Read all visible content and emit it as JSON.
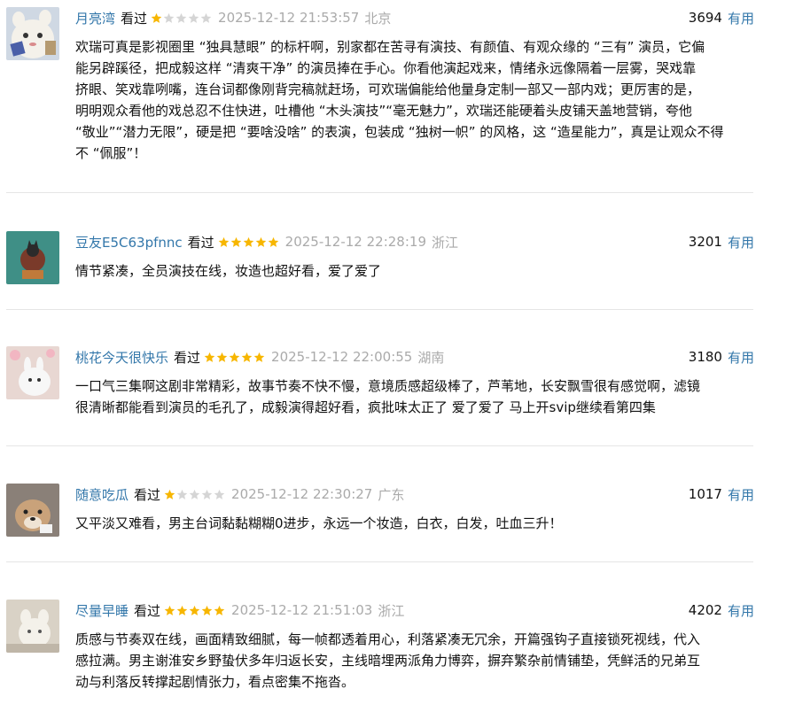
{
  "colors": {
    "link": "#3377aa",
    "star_on": "#f7b600",
    "star_off": "#d5d5d5",
    "meta_gray": "#aaaaaa"
  },
  "reviews": [
    {
      "user": "月亮湾",
      "status": "看过",
      "rating": 1,
      "timestamp": "2025-12-12 21:53:57",
      "location": "北京",
      "votes": "3694",
      "useful_label": "有用",
      "lines": [
        "欢瑞可真是影视圈里 “独具慧眼” 的标杆啊，别家都在苦寻有演技、有颜值、有观众缘的 “三有” 演员，它偏",
        "能另辟蹊径，把成毅这样 “清爽干净” 的演员捧在手心。你看他演起戏来，情绪永远像隔着一层雾，哭戏靠",
        "挤眼、笑戏靠咧嘴，连台词都像刚背完稿就赶场，可欢瑞偏能给他量身定制一部又一部内戏；更厉害的是，",
        "明明观众看他的戏总忍不住快进，吐槽他 “木头演技”“毫无魅力”，欢瑞还能硬着头皮铺天盖地营销，夸他",
        "“敬业”“潜力无限”，硬是把 “要啥没啥” 的表演，包装成 “独树一帜” 的风格，这 “造星能力”，真是让观众不得",
        "不 “佩服”！"
      ]
    },
    {
      "user": "豆友E5C63pfnnc",
      "status": "看过",
      "rating": 5,
      "timestamp": "2025-12-12 22:28:19",
      "location": "浙江",
      "votes": "3201",
      "useful_label": "有用",
      "lines": [
        "情节紧凑，全员演技在线，妆造也超好看，爱了爱了"
      ]
    },
    {
      "user": "桃花今天很快乐",
      "status": "看过",
      "rating": 5,
      "timestamp": "2025-12-12 22:00:55",
      "location": "湖南",
      "votes": "3180",
      "useful_label": "有用",
      "lines": [
        "一口气三集啊这剧非常精彩，故事节奏不快不慢，意境质感超级棒了，芦苇地，长安飘雪很有感觉啊，滤镜",
        "很清晰都能看到演员的毛孔了，成毅演得超好看，疯批味太正了 爱了爱了 马上开svip继续看第四集"
      ]
    },
    {
      "user": "随意吃瓜",
      "status": "看过",
      "rating": 1,
      "timestamp": "2025-12-12 22:30:27",
      "location": "广东",
      "votes": "1017",
      "useful_label": "有用",
      "lines": [
        "又平淡又难看，男主台词黏黏糊糊0进步，永远一个妆造，白衣，白发，吐血三升！"
      ]
    },
    {
      "user": "尽量早睡",
      "status": "看过",
      "rating": 5,
      "timestamp": "2025-12-12 21:51:03",
      "location": "浙江",
      "votes": "4202",
      "useful_label": "有用",
      "lines": [
        "质感与节奏双在线，画面精致细腻，每一帧都透着用心，利落紧凑无冗余，开篇强钩子直接锁死视线，代入",
        "感拉满。男主谢淮安乡野蛰伏多年归返长安，主线暗埋两派角力博弈，摒弃繁杂前情铺垫，凭鲜活的兄弟互",
        "动与利落反转撑起剧情张力，看点密集不拖沓。"
      ]
    }
  ]
}
